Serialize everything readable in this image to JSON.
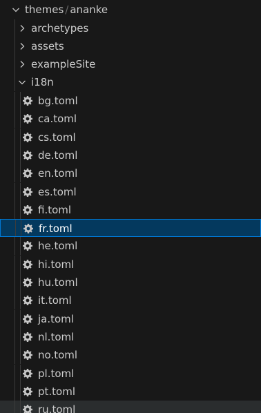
{
  "explorer": {
    "root": {
      "segments": [
        "themes",
        "ananke"
      ],
      "separator": "/",
      "expanded": true,
      "color": "#3b8eea"
    },
    "folders": [
      {
        "label": "archetypes",
        "expanded": false
      },
      {
        "label": "assets",
        "expanded": false
      },
      {
        "label": "exampleSite",
        "expanded": false
      },
      {
        "label": "i18n",
        "expanded": true
      }
    ],
    "files": [
      {
        "label": "bg.toml",
        "icon": "gear-icon"
      },
      {
        "label": "ca.toml",
        "icon": "gear-icon"
      },
      {
        "label": "cs.toml",
        "icon": "gear-icon"
      },
      {
        "label": "de.toml",
        "icon": "gear-icon"
      },
      {
        "label": "en.toml",
        "icon": "gear-icon"
      },
      {
        "label": "es.toml",
        "icon": "gear-icon"
      },
      {
        "label": "fi.toml",
        "icon": "gear-icon"
      },
      {
        "label": "fr.toml",
        "icon": "gear-icon",
        "selected": true
      },
      {
        "label": "he.toml",
        "icon": "gear-icon"
      },
      {
        "label": "hi.toml",
        "icon": "gear-icon"
      },
      {
        "label": "hu.toml",
        "icon": "gear-icon"
      },
      {
        "label": "it.toml",
        "icon": "gear-icon"
      },
      {
        "label": "ja.toml",
        "icon": "gear-icon"
      },
      {
        "label": "nl.toml",
        "icon": "gear-icon"
      },
      {
        "label": "no.toml",
        "icon": "gear-icon"
      },
      {
        "label": "pl.toml",
        "icon": "gear-icon"
      },
      {
        "label": "pt.toml",
        "icon": "gear-icon"
      },
      {
        "label": "ru.toml",
        "icon": "gear-icon",
        "hovered": true
      }
    ],
    "colors": {
      "background": "#181818",
      "text": "#cccccc",
      "selected_bg": "#04395e",
      "selected_border": "#0078d4",
      "hover_bg": "#2a2d2e",
      "icon": "#c5c5c5"
    }
  }
}
